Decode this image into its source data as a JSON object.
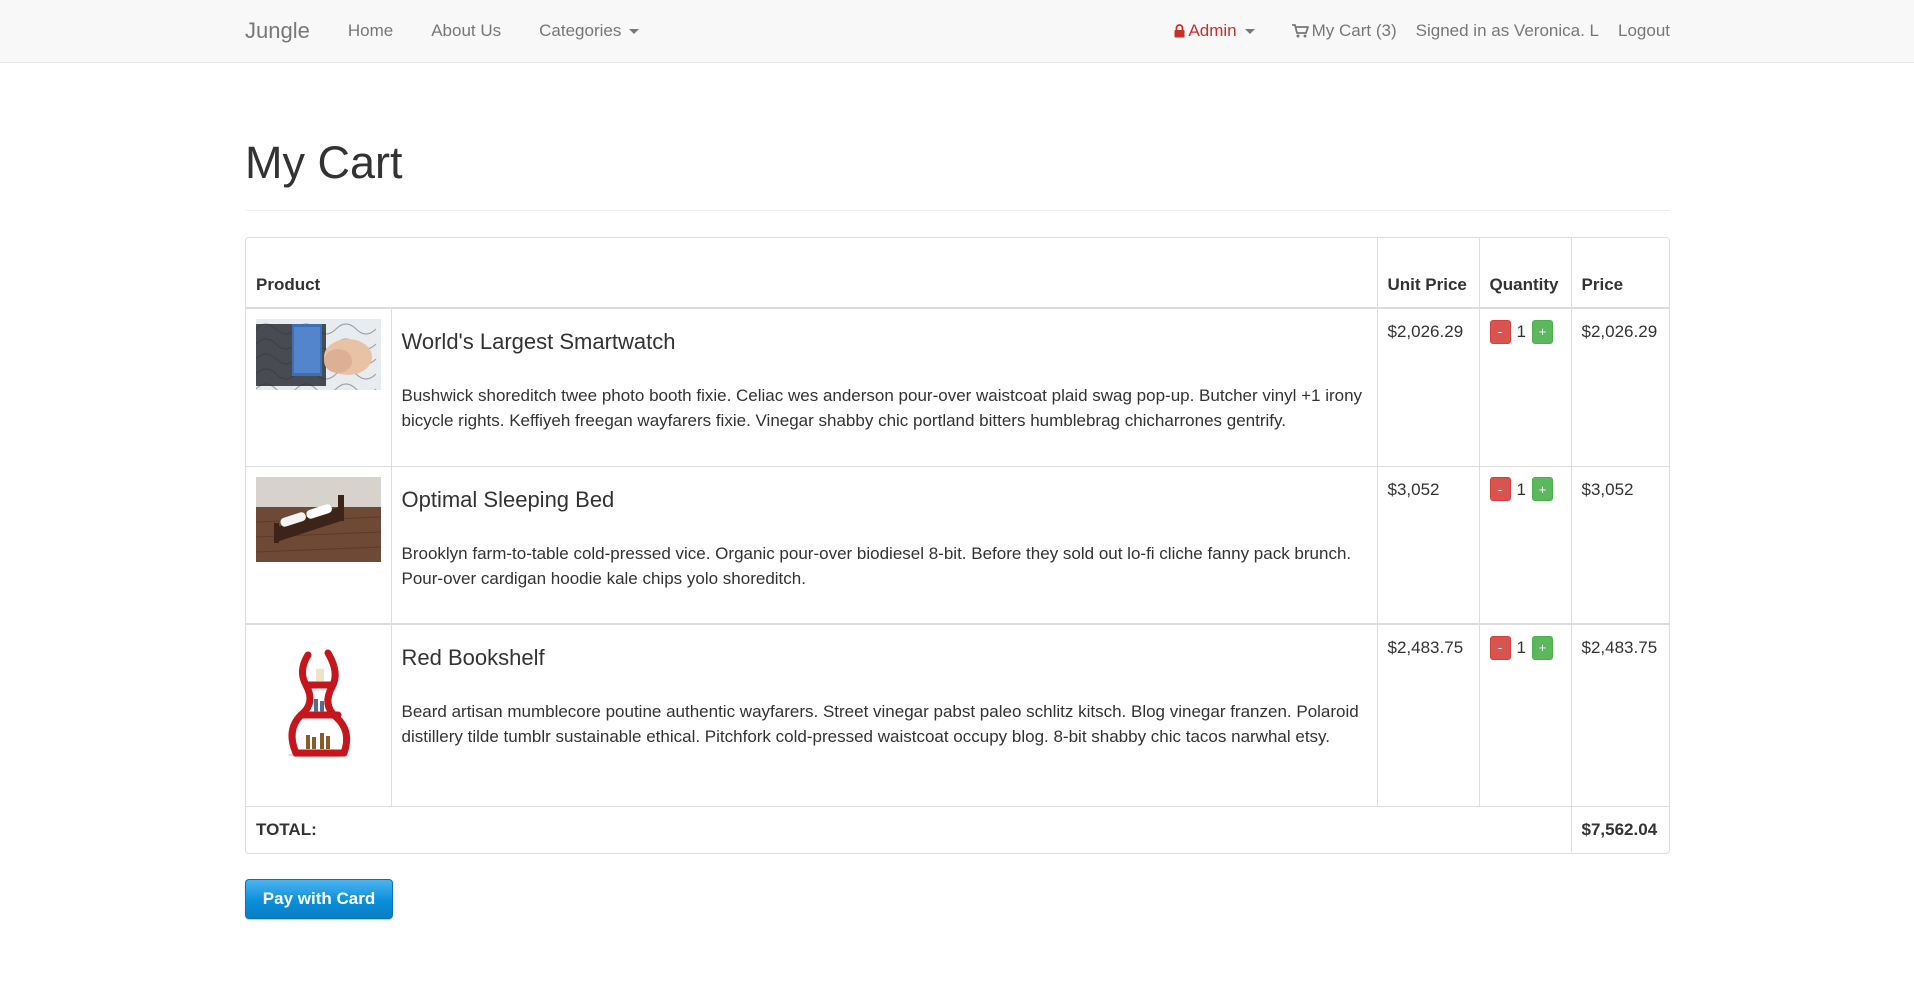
{
  "nav": {
    "brand": "Jungle",
    "home": "Home",
    "about": "About Us",
    "categories": "Categories",
    "admin": "Admin",
    "cart": "My Cart (3)",
    "signed_in": "Signed in as Veronica. L",
    "logout": "Logout"
  },
  "page": {
    "title": "My Cart"
  },
  "table": {
    "headers": {
      "product": "Product",
      "unit_price": "Unit Price",
      "quantity": "Quantity",
      "price": "Price"
    },
    "rows": [
      {
        "name": "World's Largest Smartwatch",
        "description": "Bushwick shoreditch twee photo booth fixie. Celiac wes anderson pour-over waistcoat plaid swag pop-up. Butcher vinyl +1 irony bicycle rights. Keffiyeh freegan wayfarers fixie. Vinegar shabby chic portland bitters humblebrag chicharrones gentrify.",
        "unit_price": "$2,026.29",
        "quantity": "1",
        "price": "$2,026.29"
      },
      {
        "name": "Optimal Sleeping Bed",
        "description": "Brooklyn farm-to-table cold-pressed vice. Organic pour-over biodiesel 8-bit. Before they sold out lo-fi cliche fanny pack brunch. Pour-over cardigan hoodie kale chips yolo shoreditch.",
        "unit_price": "$3,052",
        "quantity": "1",
        "price": "$3,052"
      },
      {
        "name": "Red Bookshelf",
        "description": "Beard artisan mumblecore poutine authentic wayfarers. Street vinegar pabst paleo schlitz kitsch. Blog vinegar franzen. Polaroid distillery tilde tumblr sustainable ethical. Pitchfork cold-pressed waistcoat occupy blog. 8-bit shabby chic tacos narwhal etsy.",
        "unit_price": "$2,483.75",
        "quantity": "1",
        "price": "$2,483.75"
      }
    ],
    "minus_label": "-",
    "plus_label": "+",
    "total_label": "TOTAL:",
    "total_value": "$7,562.04"
  },
  "pay_button": "Pay with Card",
  "colors": {
    "danger": "#d9534f",
    "success": "#5cb85c",
    "pay": "#0a8fdb",
    "admin": "#c9302c"
  }
}
